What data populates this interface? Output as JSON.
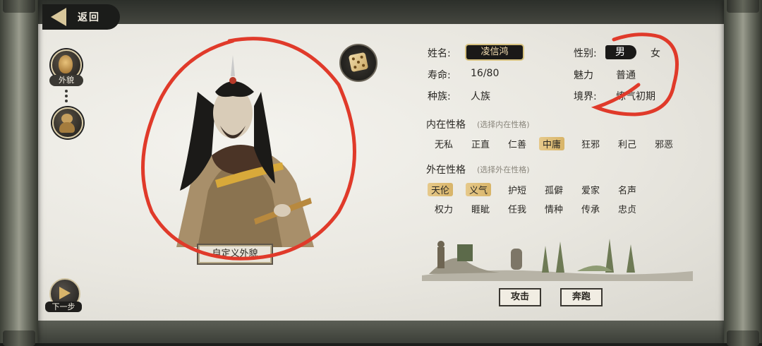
{
  "nav": {
    "back_label": "返回",
    "next_label": "下一步"
  },
  "sidebar": {
    "tabs": [
      {
        "label": "外貌"
      },
      {
        "label": ""
      }
    ]
  },
  "portrait": {
    "custom_button": "自定义外貌"
  },
  "info": {
    "name_label": "姓名:",
    "name_value": "凌信鸿",
    "gender_label": "性别:",
    "gender_male": "男",
    "gender_female": "女",
    "life_label": "寿命:",
    "life_value": "16/80",
    "charm_label": "魅力",
    "charm_value": "普通",
    "race_label": "种族:",
    "race_value": "人族",
    "realm_label": "境界:",
    "realm_value": "炼气初期"
  },
  "inner": {
    "title": "内在性格",
    "hint": "(选择内在性格)",
    "traits": [
      {
        "label": "无私",
        "selected": false
      },
      {
        "label": "正直",
        "selected": false
      },
      {
        "label": "仁善",
        "selected": false
      },
      {
        "label": "中庸",
        "selected": true
      },
      {
        "label": "狂邪",
        "selected": false
      },
      {
        "label": "利己",
        "selected": false
      },
      {
        "label": "邪恶",
        "selected": false
      }
    ]
  },
  "outer": {
    "title": "外在性格",
    "hint": "(选择外在性格)",
    "row1": [
      {
        "label": "天伦",
        "selected": true
      },
      {
        "label": "义气",
        "selected": true
      },
      {
        "label": "护短",
        "selected": false
      },
      {
        "label": "孤僻",
        "selected": false
      },
      {
        "label": "爱家",
        "selected": false
      },
      {
        "label": "名声",
        "selected": false
      }
    ],
    "row2": [
      {
        "label": "权力",
        "selected": false
      },
      {
        "label": "睚眦",
        "selected": false
      },
      {
        "label": "任我",
        "selected": false
      },
      {
        "label": "情种",
        "selected": false
      },
      {
        "label": "传承",
        "selected": false
      },
      {
        "label": "忠贞",
        "selected": false
      }
    ]
  },
  "actions": {
    "attack": "攻击",
    "flee": "奔跑"
  },
  "colors": {
    "annotation": "#e03a2a",
    "selected_trait": "#dcbc74"
  }
}
